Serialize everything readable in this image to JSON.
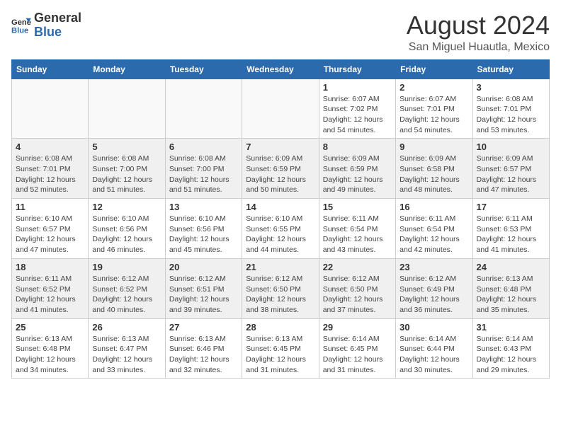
{
  "header": {
    "logo_line1": "General",
    "logo_line2": "Blue",
    "title": "August 2024",
    "subtitle": "San Miguel Huautla, Mexico"
  },
  "weekdays": [
    "Sunday",
    "Monday",
    "Tuesday",
    "Wednesday",
    "Thursday",
    "Friday",
    "Saturday"
  ],
  "weeks": [
    [
      {
        "day": "",
        "info": ""
      },
      {
        "day": "",
        "info": ""
      },
      {
        "day": "",
        "info": ""
      },
      {
        "day": "",
        "info": ""
      },
      {
        "day": "1",
        "info": "Sunrise: 6:07 AM\nSunset: 7:02 PM\nDaylight: 12 hours\nand 54 minutes."
      },
      {
        "day": "2",
        "info": "Sunrise: 6:07 AM\nSunset: 7:01 PM\nDaylight: 12 hours\nand 54 minutes."
      },
      {
        "day": "3",
        "info": "Sunrise: 6:08 AM\nSunset: 7:01 PM\nDaylight: 12 hours\nand 53 minutes."
      }
    ],
    [
      {
        "day": "4",
        "info": "Sunrise: 6:08 AM\nSunset: 7:01 PM\nDaylight: 12 hours\nand 52 minutes."
      },
      {
        "day": "5",
        "info": "Sunrise: 6:08 AM\nSunset: 7:00 PM\nDaylight: 12 hours\nand 51 minutes."
      },
      {
        "day": "6",
        "info": "Sunrise: 6:08 AM\nSunset: 7:00 PM\nDaylight: 12 hours\nand 51 minutes."
      },
      {
        "day": "7",
        "info": "Sunrise: 6:09 AM\nSunset: 6:59 PM\nDaylight: 12 hours\nand 50 minutes."
      },
      {
        "day": "8",
        "info": "Sunrise: 6:09 AM\nSunset: 6:59 PM\nDaylight: 12 hours\nand 49 minutes."
      },
      {
        "day": "9",
        "info": "Sunrise: 6:09 AM\nSunset: 6:58 PM\nDaylight: 12 hours\nand 48 minutes."
      },
      {
        "day": "10",
        "info": "Sunrise: 6:09 AM\nSunset: 6:57 PM\nDaylight: 12 hours\nand 47 minutes."
      }
    ],
    [
      {
        "day": "11",
        "info": "Sunrise: 6:10 AM\nSunset: 6:57 PM\nDaylight: 12 hours\nand 47 minutes."
      },
      {
        "day": "12",
        "info": "Sunrise: 6:10 AM\nSunset: 6:56 PM\nDaylight: 12 hours\nand 46 minutes."
      },
      {
        "day": "13",
        "info": "Sunrise: 6:10 AM\nSunset: 6:56 PM\nDaylight: 12 hours\nand 45 minutes."
      },
      {
        "day": "14",
        "info": "Sunrise: 6:10 AM\nSunset: 6:55 PM\nDaylight: 12 hours\nand 44 minutes."
      },
      {
        "day": "15",
        "info": "Sunrise: 6:11 AM\nSunset: 6:54 PM\nDaylight: 12 hours\nand 43 minutes."
      },
      {
        "day": "16",
        "info": "Sunrise: 6:11 AM\nSunset: 6:54 PM\nDaylight: 12 hours\nand 42 minutes."
      },
      {
        "day": "17",
        "info": "Sunrise: 6:11 AM\nSunset: 6:53 PM\nDaylight: 12 hours\nand 41 minutes."
      }
    ],
    [
      {
        "day": "18",
        "info": "Sunrise: 6:11 AM\nSunset: 6:52 PM\nDaylight: 12 hours\nand 41 minutes."
      },
      {
        "day": "19",
        "info": "Sunrise: 6:12 AM\nSunset: 6:52 PM\nDaylight: 12 hours\nand 40 minutes."
      },
      {
        "day": "20",
        "info": "Sunrise: 6:12 AM\nSunset: 6:51 PM\nDaylight: 12 hours\nand 39 minutes."
      },
      {
        "day": "21",
        "info": "Sunrise: 6:12 AM\nSunset: 6:50 PM\nDaylight: 12 hours\nand 38 minutes."
      },
      {
        "day": "22",
        "info": "Sunrise: 6:12 AM\nSunset: 6:50 PM\nDaylight: 12 hours\nand 37 minutes."
      },
      {
        "day": "23",
        "info": "Sunrise: 6:12 AM\nSunset: 6:49 PM\nDaylight: 12 hours\nand 36 minutes."
      },
      {
        "day": "24",
        "info": "Sunrise: 6:13 AM\nSunset: 6:48 PM\nDaylight: 12 hours\nand 35 minutes."
      }
    ],
    [
      {
        "day": "25",
        "info": "Sunrise: 6:13 AM\nSunset: 6:48 PM\nDaylight: 12 hours\nand 34 minutes."
      },
      {
        "day": "26",
        "info": "Sunrise: 6:13 AM\nSunset: 6:47 PM\nDaylight: 12 hours\nand 33 minutes."
      },
      {
        "day": "27",
        "info": "Sunrise: 6:13 AM\nSunset: 6:46 PM\nDaylight: 12 hours\nand 32 minutes."
      },
      {
        "day": "28",
        "info": "Sunrise: 6:13 AM\nSunset: 6:45 PM\nDaylight: 12 hours\nand 31 minutes."
      },
      {
        "day": "29",
        "info": "Sunrise: 6:14 AM\nSunset: 6:45 PM\nDaylight: 12 hours\nand 31 minutes."
      },
      {
        "day": "30",
        "info": "Sunrise: 6:14 AM\nSunset: 6:44 PM\nDaylight: 12 hours\nand 30 minutes."
      },
      {
        "day": "31",
        "info": "Sunrise: 6:14 AM\nSunset: 6:43 PM\nDaylight: 12 hours\nand 29 minutes."
      }
    ]
  ]
}
